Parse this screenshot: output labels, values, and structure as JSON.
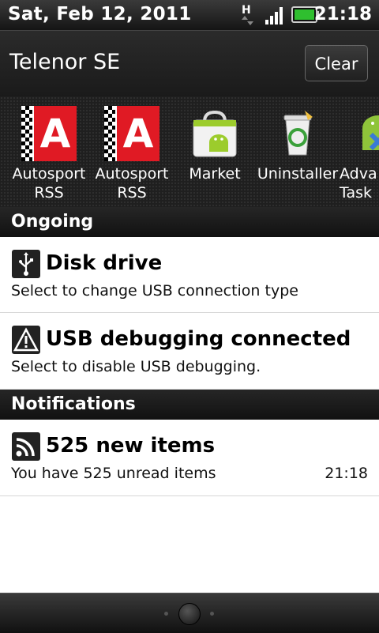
{
  "status_bar": {
    "date": "Sat, Feb 12, 2011",
    "time": "21:18",
    "network_type": "H",
    "icons": [
      "data-activity-icon",
      "signal-strength-icon",
      "battery-icon"
    ]
  },
  "header": {
    "carrier": "Telenor SE",
    "clear_label": "Clear"
  },
  "apps": [
    {
      "label": "Autosport\nRSS",
      "icon": "autosport-icon"
    },
    {
      "label": "Autosport\nRSS",
      "icon": "autosport-icon"
    },
    {
      "label": "Market",
      "icon": "market-icon"
    },
    {
      "label": "Uninstaller",
      "icon": "uninstaller-icon"
    },
    {
      "label": "Adva\nTask",
      "icon": "advanced-task-icon"
    }
  ],
  "ongoing": {
    "header": "Ongoing",
    "items": [
      {
        "title": "Disk drive",
        "subtitle": "Select to change USB connection type",
        "icon": "usb-icon"
      },
      {
        "title": "USB debugging connected",
        "subtitle": "Select to disable USB debugging.",
        "icon": "warning-icon"
      }
    ]
  },
  "notifications": {
    "header": "Notifications",
    "items": [
      {
        "title": "525 new items",
        "subtitle": "You have 525 unread items",
        "time": "21:18",
        "icon": "rss-icon"
      }
    ]
  },
  "colors": {
    "autosport_red": "#e01a24",
    "battery_green": "#2fbf2f",
    "dark_bar": "#1a1a1a"
  }
}
